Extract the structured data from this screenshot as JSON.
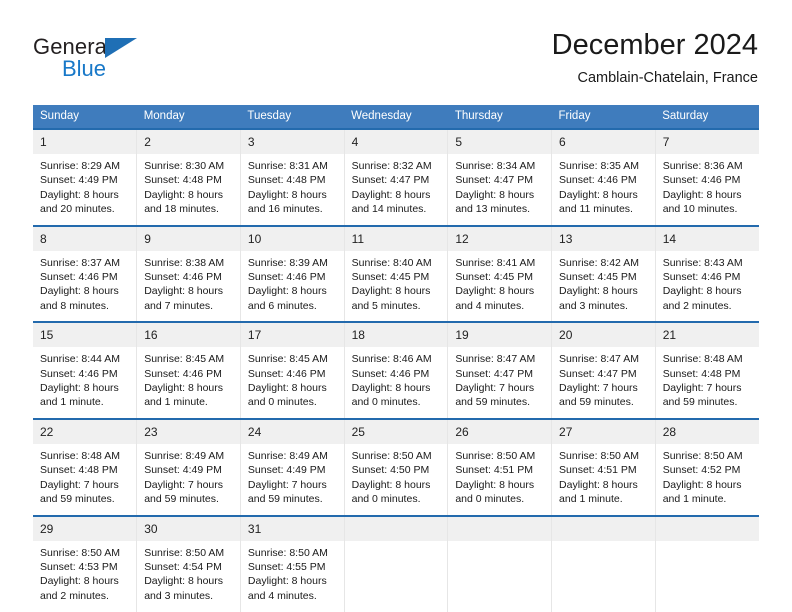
{
  "brand": {
    "name_part1": "General",
    "name_part2": "Blue",
    "triangle_color": "#1f6fb5",
    "blue_text_color": "#1878c8"
  },
  "header": {
    "title": "December 2024",
    "subtitle": "Camblain-Chatelain, France"
  },
  "theme": {
    "header_blue": "#3f7cbd",
    "row_rule_blue": "#236aad",
    "daynum_band": "#f0f0f0",
    "cell_divider": "#e6e6e6"
  },
  "weekdays": [
    "Sunday",
    "Monday",
    "Tuesday",
    "Wednesday",
    "Thursday",
    "Friday",
    "Saturday"
  ],
  "labels": {
    "sunrise_prefix": "Sunrise:",
    "sunset_prefix": "Sunset:",
    "daylight_prefix": "Daylight:"
  },
  "weeks": [
    [
      {
        "day": "1",
        "sunrise": "Sunrise: 8:29 AM",
        "sunset": "Sunset: 4:49 PM",
        "daylight_line1": "Daylight: 8 hours",
        "daylight_line2": "and 20 minutes."
      },
      {
        "day": "2",
        "sunrise": "Sunrise: 8:30 AM",
        "sunset": "Sunset: 4:48 PM",
        "daylight_line1": "Daylight: 8 hours",
        "daylight_line2": "and 18 minutes."
      },
      {
        "day": "3",
        "sunrise": "Sunrise: 8:31 AM",
        "sunset": "Sunset: 4:48 PM",
        "daylight_line1": "Daylight: 8 hours",
        "daylight_line2": "and 16 minutes."
      },
      {
        "day": "4",
        "sunrise": "Sunrise: 8:32 AM",
        "sunset": "Sunset: 4:47 PM",
        "daylight_line1": "Daylight: 8 hours",
        "daylight_line2": "and 14 minutes."
      },
      {
        "day": "5",
        "sunrise": "Sunrise: 8:34 AM",
        "sunset": "Sunset: 4:47 PM",
        "daylight_line1": "Daylight: 8 hours",
        "daylight_line2": "and 13 minutes."
      },
      {
        "day": "6",
        "sunrise": "Sunrise: 8:35 AM",
        "sunset": "Sunset: 4:46 PM",
        "daylight_line1": "Daylight: 8 hours",
        "daylight_line2": "and 11 minutes."
      },
      {
        "day": "7",
        "sunrise": "Sunrise: 8:36 AM",
        "sunset": "Sunset: 4:46 PM",
        "daylight_line1": "Daylight: 8 hours",
        "daylight_line2": "and 10 minutes."
      }
    ],
    [
      {
        "day": "8",
        "sunrise": "Sunrise: 8:37 AM",
        "sunset": "Sunset: 4:46 PM",
        "daylight_line1": "Daylight: 8 hours",
        "daylight_line2": "and 8 minutes."
      },
      {
        "day": "9",
        "sunrise": "Sunrise: 8:38 AM",
        "sunset": "Sunset: 4:46 PM",
        "daylight_line1": "Daylight: 8 hours",
        "daylight_line2": "and 7 minutes."
      },
      {
        "day": "10",
        "sunrise": "Sunrise: 8:39 AM",
        "sunset": "Sunset: 4:46 PM",
        "daylight_line1": "Daylight: 8 hours",
        "daylight_line2": "and 6 minutes."
      },
      {
        "day": "11",
        "sunrise": "Sunrise: 8:40 AM",
        "sunset": "Sunset: 4:45 PM",
        "daylight_line1": "Daylight: 8 hours",
        "daylight_line2": "and 5 minutes."
      },
      {
        "day": "12",
        "sunrise": "Sunrise: 8:41 AM",
        "sunset": "Sunset: 4:45 PM",
        "daylight_line1": "Daylight: 8 hours",
        "daylight_line2": "and 4 minutes."
      },
      {
        "day": "13",
        "sunrise": "Sunrise: 8:42 AM",
        "sunset": "Sunset: 4:45 PM",
        "daylight_line1": "Daylight: 8 hours",
        "daylight_line2": "and 3 minutes."
      },
      {
        "day": "14",
        "sunrise": "Sunrise: 8:43 AM",
        "sunset": "Sunset: 4:46 PM",
        "daylight_line1": "Daylight: 8 hours",
        "daylight_line2": "and 2 minutes."
      }
    ],
    [
      {
        "day": "15",
        "sunrise": "Sunrise: 8:44 AM",
        "sunset": "Sunset: 4:46 PM",
        "daylight_line1": "Daylight: 8 hours",
        "daylight_line2": "and 1 minute."
      },
      {
        "day": "16",
        "sunrise": "Sunrise: 8:45 AM",
        "sunset": "Sunset: 4:46 PM",
        "daylight_line1": "Daylight: 8 hours",
        "daylight_line2": "and 1 minute."
      },
      {
        "day": "17",
        "sunrise": "Sunrise: 8:45 AM",
        "sunset": "Sunset: 4:46 PM",
        "daylight_line1": "Daylight: 8 hours",
        "daylight_line2": "and 0 minutes."
      },
      {
        "day": "18",
        "sunrise": "Sunrise: 8:46 AM",
        "sunset": "Sunset: 4:46 PM",
        "daylight_line1": "Daylight: 8 hours",
        "daylight_line2": "and 0 minutes."
      },
      {
        "day": "19",
        "sunrise": "Sunrise: 8:47 AM",
        "sunset": "Sunset: 4:47 PM",
        "daylight_line1": "Daylight: 7 hours",
        "daylight_line2": "and 59 minutes."
      },
      {
        "day": "20",
        "sunrise": "Sunrise: 8:47 AM",
        "sunset": "Sunset: 4:47 PM",
        "daylight_line1": "Daylight: 7 hours",
        "daylight_line2": "and 59 minutes."
      },
      {
        "day": "21",
        "sunrise": "Sunrise: 8:48 AM",
        "sunset": "Sunset: 4:48 PM",
        "daylight_line1": "Daylight: 7 hours",
        "daylight_line2": "and 59 minutes."
      }
    ],
    [
      {
        "day": "22",
        "sunrise": "Sunrise: 8:48 AM",
        "sunset": "Sunset: 4:48 PM",
        "daylight_line1": "Daylight: 7 hours",
        "daylight_line2": "and 59 minutes."
      },
      {
        "day": "23",
        "sunrise": "Sunrise: 8:49 AM",
        "sunset": "Sunset: 4:49 PM",
        "daylight_line1": "Daylight: 7 hours",
        "daylight_line2": "and 59 minutes."
      },
      {
        "day": "24",
        "sunrise": "Sunrise: 8:49 AM",
        "sunset": "Sunset: 4:49 PM",
        "daylight_line1": "Daylight: 7 hours",
        "daylight_line2": "and 59 minutes."
      },
      {
        "day": "25",
        "sunrise": "Sunrise: 8:50 AM",
        "sunset": "Sunset: 4:50 PM",
        "daylight_line1": "Daylight: 8 hours",
        "daylight_line2": "and 0 minutes."
      },
      {
        "day": "26",
        "sunrise": "Sunrise: 8:50 AM",
        "sunset": "Sunset: 4:51 PM",
        "daylight_line1": "Daylight: 8 hours",
        "daylight_line2": "and 0 minutes."
      },
      {
        "day": "27",
        "sunrise": "Sunrise: 8:50 AM",
        "sunset": "Sunset: 4:51 PM",
        "daylight_line1": "Daylight: 8 hours",
        "daylight_line2": "and 1 minute."
      },
      {
        "day": "28",
        "sunrise": "Sunrise: 8:50 AM",
        "sunset": "Sunset: 4:52 PM",
        "daylight_line1": "Daylight: 8 hours",
        "daylight_line2": "and 1 minute."
      }
    ],
    [
      {
        "day": "29",
        "sunrise": "Sunrise: 8:50 AM",
        "sunset": "Sunset: 4:53 PM",
        "daylight_line1": "Daylight: 8 hours",
        "daylight_line2": "and 2 minutes."
      },
      {
        "day": "30",
        "sunrise": "Sunrise: 8:50 AM",
        "sunset": "Sunset: 4:54 PM",
        "daylight_line1": "Daylight: 8 hours",
        "daylight_line2": "and 3 minutes."
      },
      {
        "day": "31",
        "sunrise": "Sunrise: 8:50 AM",
        "sunset": "Sunset: 4:55 PM",
        "daylight_line1": "Daylight: 8 hours",
        "daylight_line2": "and 4 minutes."
      },
      {
        "day": "",
        "sunrise": "",
        "sunset": "",
        "daylight_line1": "",
        "daylight_line2": ""
      },
      {
        "day": "",
        "sunrise": "",
        "sunset": "",
        "daylight_line1": "",
        "daylight_line2": ""
      },
      {
        "day": "",
        "sunrise": "",
        "sunset": "",
        "daylight_line1": "",
        "daylight_line2": ""
      },
      {
        "day": "",
        "sunrise": "",
        "sunset": "",
        "daylight_line1": "",
        "daylight_line2": ""
      }
    ]
  ]
}
